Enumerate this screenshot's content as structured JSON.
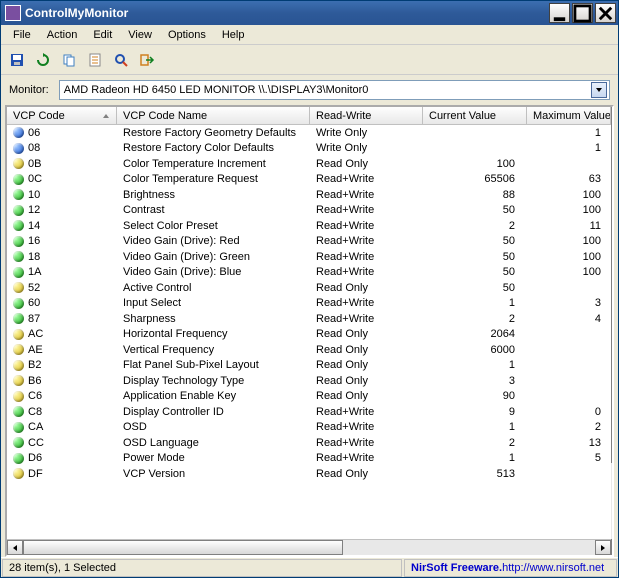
{
  "window": {
    "title": "ControlMyMonitor"
  },
  "menu": [
    "File",
    "Action",
    "Edit",
    "View",
    "Options",
    "Help"
  ],
  "monitor": {
    "label": "Monitor:",
    "value": "AMD Radeon HD 6450  LED MONITOR   \\\\.\\DISPLAY3\\Monitor0"
  },
  "columns": [
    "VCP Code",
    "VCP Code Name",
    "Read-Write",
    "Current Value",
    "Maximum Value"
  ],
  "rows": [
    {
      "dot": "blue",
      "code": "06",
      "name": "Restore Factory Geometry Defaults",
      "rw": "Write Only",
      "cur": "",
      "max": "1"
    },
    {
      "dot": "blue",
      "code": "08",
      "name": "Restore Factory Color Defaults",
      "rw": "Write Only",
      "cur": "",
      "max": "1"
    },
    {
      "dot": "yellow",
      "code": "0B",
      "name": "Color Temperature Increment",
      "rw": "Read Only",
      "cur": "100",
      "max": ""
    },
    {
      "dot": "green",
      "code": "0C",
      "name": "Color Temperature Request",
      "rw": "Read+Write",
      "cur": "65506",
      "max": "63"
    },
    {
      "dot": "green",
      "code": "10",
      "name": "Brightness",
      "rw": "Read+Write",
      "cur": "88",
      "max": "100"
    },
    {
      "dot": "green",
      "code": "12",
      "name": "Contrast",
      "rw": "Read+Write",
      "cur": "50",
      "max": "100"
    },
    {
      "dot": "green",
      "code": "14",
      "name": "Select Color Preset",
      "rw": "Read+Write",
      "cur": "2",
      "max": "11"
    },
    {
      "dot": "green",
      "code": "16",
      "name": "Video Gain (Drive): Red",
      "rw": "Read+Write",
      "cur": "50",
      "max": "100"
    },
    {
      "dot": "green",
      "code": "18",
      "name": "Video Gain (Drive): Green",
      "rw": "Read+Write",
      "cur": "50",
      "max": "100"
    },
    {
      "dot": "green",
      "code": "1A",
      "name": "Video Gain (Drive): Blue",
      "rw": "Read+Write",
      "cur": "50",
      "max": "100"
    },
    {
      "dot": "yellow",
      "code": "52",
      "name": "Active Control",
      "rw": "Read Only",
      "cur": "50",
      "max": ""
    },
    {
      "dot": "green",
      "code": "60",
      "name": "Input Select",
      "rw": "Read+Write",
      "cur": "1",
      "max": "3"
    },
    {
      "dot": "green",
      "code": "87",
      "name": "Sharpness",
      "rw": "Read+Write",
      "cur": "2",
      "max": "4"
    },
    {
      "dot": "yellow",
      "code": "AC",
      "name": "Horizontal Frequency",
      "rw": "Read Only",
      "cur": "2064",
      "max": ""
    },
    {
      "dot": "yellow",
      "code": "AE",
      "name": "Vertical Frequency",
      "rw": "Read Only",
      "cur": "6000",
      "max": ""
    },
    {
      "dot": "yellow",
      "code": "B2",
      "name": "Flat Panel Sub-Pixel Layout",
      "rw": "Read Only",
      "cur": "1",
      "max": ""
    },
    {
      "dot": "yellow",
      "code": "B6",
      "name": "Display Technology Type",
      "rw": "Read Only",
      "cur": "3",
      "max": ""
    },
    {
      "dot": "yellow",
      "code": "C6",
      "name": "Application Enable Key",
      "rw": "Read Only",
      "cur": "90",
      "max": ""
    },
    {
      "dot": "green",
      "code": "C8",
      "name": "Display Controller ID",
      "rw": "Read+Write",
      "cur": "9",
      "max": "0"
    },
    {
      "dot": "green",
      "code": "CA",
      "name": "OSD",
      "rw": "Read+Write",
      "cur": "1",
      "max": "2"
    },
    {
      "dot": "green",
      "code": "CC",
      "name": "OSD Language",
      "rw": "Read+Write",
      "cur": "2",
      "max": "13"
    },
    {
      "dot": "green",
      "code": "D6",
      "name": "Power Mode",
      "rw": "Read+Write",
      "cur": "1",
      "max": "5"
    },
    {
      "dot": "yellow",
      "code": "DF",
      "name": "VCP Version",
      "rw": "Read Only",
      "cur": "513",
      "max": ""
    }
  ],
  "status": {
    "items": "28 item(s), 1 Selected",
    "brand": "NirSoft Freeware. ",
    "url_text": "http://www.nirsoft.net"
  }
}
